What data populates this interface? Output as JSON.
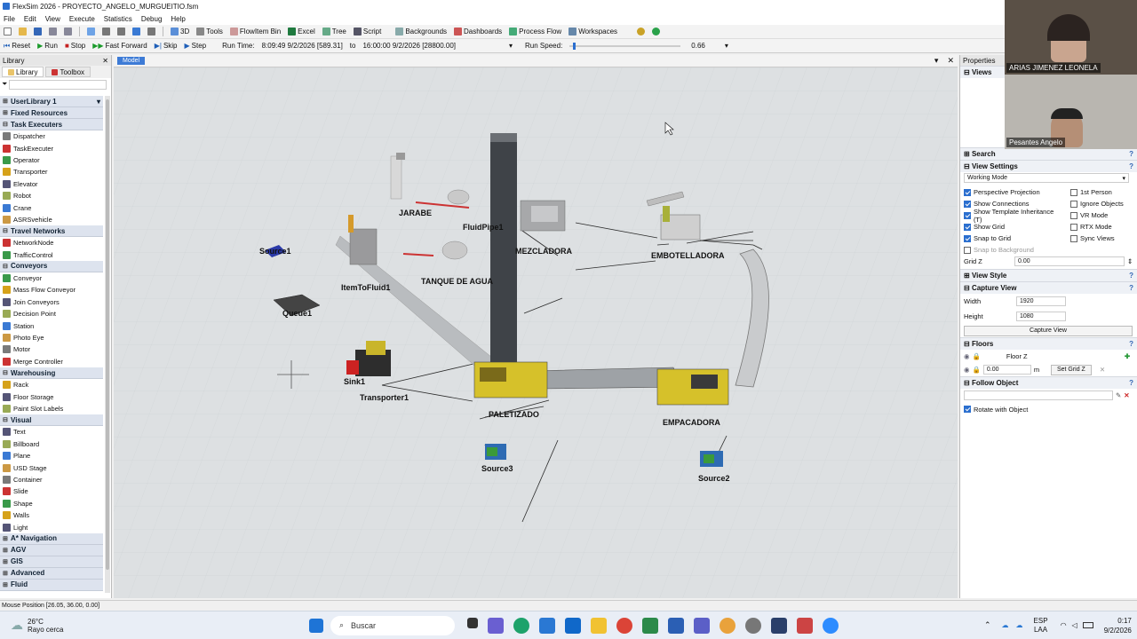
{
  "window": {
    "title": "FlexSim 2026 - PROYECTO_ANGELO_MURGUEITIO.fsm"
  },
  "menu": [
    "File",
    "Edit",
    "View",
    "Execute",
    "Statistics",
    "Debug",
    "Help"
  ],
  "toolbar": {
    "items": [
      "3D",
      "Tools",
      "FlowItem Bin",
      "Excel",
      "Tree",
      "Script",
      "Backgrounds",
      "Dashboards",
      "Process Flow",
      "Workspaces"
    ]
  },
  "runbar": {
    "reset": "Reset",
    "run": "Run",
    "stop": "Stop",
    "fast_forward": "Fast Forward",
    "skip": "Skip",
    "step": "Step",
    "run_time_label": "Run Time:",
    "run_time_value": "8:09:49 9/2/2026 [589.31]",
    "run_time_to": "to",
    "run_time_end": "16:00:00 9/2/2026 [28800.00]",
    "run_speed_label": "Run Speed:",
    "run_speed_value": "0.66",
    "run_speed_fraction": 0.03
  },
  "library": {
    "title": "Library",
    "tabs": [
      "Library",
      "Toolbox"
    ],
    "categories": [
      {
        "name": "UserLibrary 1",
        "items": []
      },
      {
        "name": "Fixed Resources",
        "items": []
      },
      {
        "name": "Task Executers",
        "items": [
          "Dispatcher",
          "TaskExecuter",
          "Operator",
          "Transporter",
          "Elevator",
          "Robot",
          "Crane",
          "ASRSvehicle"
        ]
      },
      {
        "name": "Travel Networks",
        "items": [
          "NetworkNode",
          "TrafficControl"
        ]
      },
      {
        "name": "Conveyors",
        "items": [
          "Conveyor",
          "Mass Flow Conveyor",
          "Join Conveyors",
          "Decision Point",
          "Station",
          "Photo Eye",
          "Motor",
          "Merge Controller"
        ]
      },
      {
        "name": "Warehousing",
        "items": [
          "Rack",
          "Floor Storage",
          "Paint Slot Labels"
        ]
      },
      {
        "name": "Visual",
        "items": [
          "Text",
          "Billboard",
          "Plane",
          "USD Stage",
          "Container",
          "Slide",
          "Shape",
          "Walls",
          "Light"
        ]
      },
      {
        "name": "A* Navigation",
        "items": []
      },
      {
        "name": "AGV",
        "items": []
      },
      {
        "name": "GIS",
        "items": []
      },
      {
        "name": "Advanced",
        "items": []
      },
      {
        "name": "Fluid",
        "items": []
      }
    ]
  },
  "model": {
    "tab": "Model",
    "labels": {
      "jarabe": "JARABE",
      "fluidpipe": "FluidPipe1",
      "mezcladora": "MEZCLADORA",
      "embotelladora": "EMBOTELLADORA",
      "source1": "Source1",
      "itemtofluid": "ItemToFluid1",
      "tanque": "TANQUE DE AGUA",
      "queue": "Queue1",
      "sink": "Sink1",
      "transporter": "Transporter1",
      "paletizado": "PALETIZADO",
      "empacadora": "EMPACADORA",
      "source3": "Source3",
      "source2": "Source2"
    }
  },
  "properties": {
    "title": "Properties",
    "views": "Views",
    "search": "Search",
    "view_settings": "View Settings",
    "working_mode": "Working Mode",
    "checks_left": [
      {
        "label": "Perspective Projection",
        "on": true
      },
      {
        "label": "Show Connections",
        "on": true
      },
      {
        "label": "Show Template Inheritance (T)",
        "on": true
      },
      {
        "label": "Show Grid",
        "on": true
      },
      {
        "label": "Snap to Grid",
        "on": true
      },
      {
        "label": "Snap to Background",
        "on": false
      }
    ],
    "checks_right": [
      {
        "label": "1st Person",
        "on": false
      },
      {
        "label": "Ignore Objects",
        "on": false
      },
      {
        "label": "VR Mode",
        "on": false
      },
      {
        "label": "RTX Mode",
        "on": false
      },
      {
        "label": "Sync Views",
        "on": false
      }
    ],
    "grid_z_label": "Grid Z",
    "grid_z_value": "0.00",
    "view_style": "View Style",
    "capture_view": "Capture View",
    "width_label": "Width",
    "width_value": "1920",
    "height_label": "Height",
    "height_value": "1080",
    "capture_button": "Capture View",
    "floors": "Floors",
    "floor_name": "Floor Z",
    "floor_value": "0.00",
    "floor_unit": "m",
    "set_grid_z": "Set Grid Z",
    "follow_object": "Follow Object",
    "rotate_with_object": "Rotate with Object"
  },
  "video": {
    "participant1": "ARIAS JIMENEZ LEONELA",
    "participant2": "Pesantes Angelo"
  },
  "status": {
    "mouse_position": "Mouse Position [26.05, 36.00, 0.00]"
  },
  "taskbar": {
    "weather_temp": "26°C",
    "weather_desc": "Rayo cerca",
    "search_placeholder": "Buscar",
    "lang1": "ESP",
    "lang2": "LAA",
    "time": "0:17",
    "date": "9/2/2026"
  }
}
